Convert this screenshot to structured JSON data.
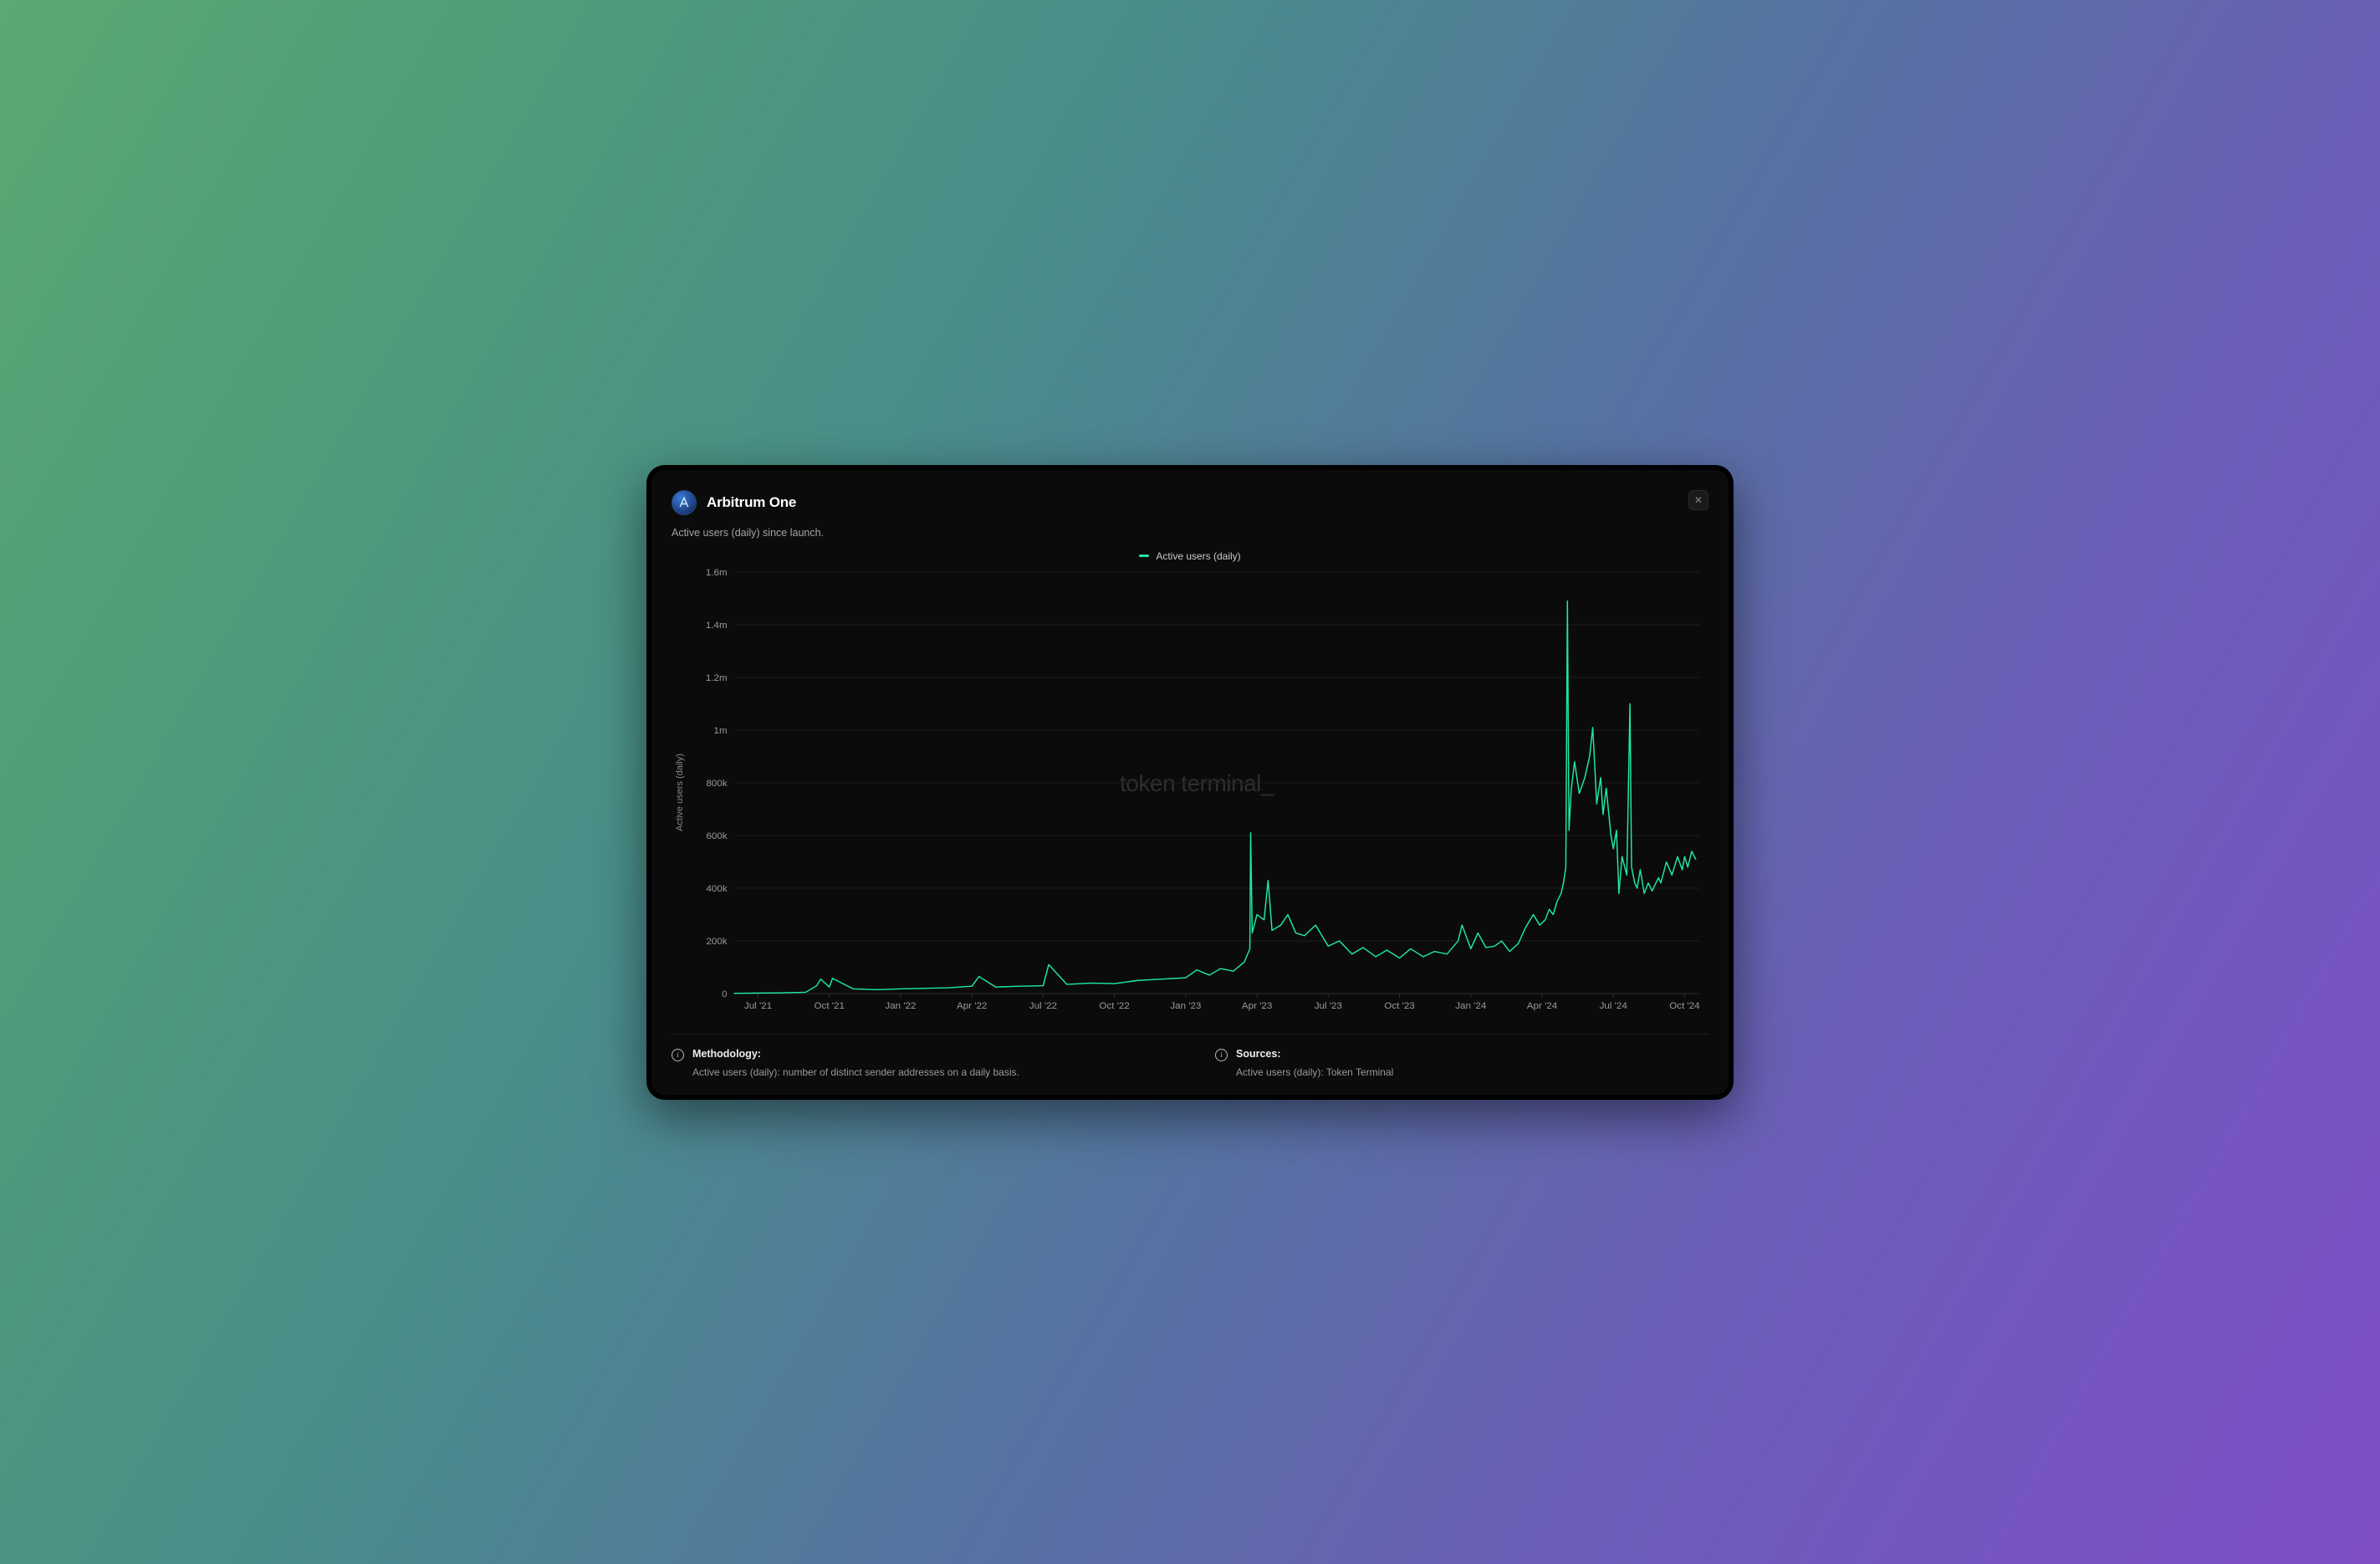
{
  "header": {
    "title": "Arbitrum One",
    "subtitle": "Active users (daily) since launch.",
    "close_label": "✕"
  },
  "legend": {
    "series_label": "Active users (daily)",
    "series_color": "#1de9a4"
  },
  "watermark": "token terminal_",
  "footer": {
    "methodology_heading": "Methodology:",
    "methodology_body": "Active users (daily): number of distinct sender addresses on a daily basis.",
    "sources_heading": "Sources:",
    "sources_body": "Active users (daily): Token Terminal"
  },
  "chart_data": {
    "type": "line",
    "title": "Arbitrum One — Active users (daily) since launch",
    "xlabel": "",
    "ylabel": "Active users (daily)",
    "ylim": [
      0,
      1600000
    ],
    "x_ticks": [
      "Jul '21",
      "Oct '21",
      "Jan '22",
      "Apr '22",
      "Jul '22",
      "Oct '22",
      "Jan '23",
      "Apr '23",
      "Jul '23",
      "Oct '23",
      "Jan '24",
      "Apr '24",
      "Jul '24",
      "Oct '24"
    ],
    "y_ticks": [
      0,
      200000,
      400000,
      600000,
      800000,
      1000000,
      1200000,
      1400000,
      1600000
    ],
    "y_tick_labels": [
      "0",
      "200k",
      "400k",
      "600k",
      "800k",
      "1m",
      "1.2m",
      "1.4m",
      "1.6m"
    ],
    "legend_entries": [
      "Active users (daily)"
    ],
    "series": [
      {
        "name": "Active users (daily)",
        "color": "#1de9a4",
        "x": [
          "2021-06",
          "2021-07",
          "2021-08",
          "2021-09-01",
          "2021-09-15",
          "2021-09-20",
          "2021-10-01",
          "2021-10-05",
          "2021-11",
          "2021-12",
          "2022-01",
          "2022-02",
          "2022-03",
          "2022-04-01",
          "2022-04-10",
          "2022-05",
          "2022-06",
          "2022-07-01",
          "2022-07-08",
          "2022-08",
          "2022-09",
          "2022-10",
          "2022-11",
          "2022-12",
          "2023-01-01",
          "2023-01-15",
          "2023-02-01",
          "2023-02-15",
          "2023-03-01",
          "2023-03-15",
          "2023-03-22",
          "2023-03-23",
          "2023-03-25",
          "2023-04-01",
          "2023-04-10",
          "2023-04-15",
          "2023-04-20",
          "2023-05-01",
          "2023-05-10",
          "2023-05-20",
          "2023-06-01",
          "2023-06-15",
          "2023-07",
          "2023-07-15",
          "2023-08",
          "2023-08-15",
          "2023-09",
          "2023-09-15",
          "2023-10",
          "2023-10-15",
          "2023-11",
          "2023-11-15",
          "2023-12",
          "2023-12-15",
          "2023-12-20",
          "2024-01-01",
          "2024-01-10",
          "2024-01-20",
          "2024-02-01",
          "2024-02-10",
          "2024-02-20",
          "2024-03-01",
          "2024-03-10",
          "2024-03-20",
          "2024-03-28",
          "2024-04-05",
          "2024-04-10",
          "2024-04-15",
          "2024-04-20",
          "2024-04-25",
          "2024-04-28",
          "2024-05-01",
          "2024-05-03",
          "2024-05-05",
          "2024-05-08",
          "2024-05-12",
          "2024-05-18",
          "2024-05-25",
          "2024-06-01",
          "2024-06-05",
          "2024-06-10",
          "2024-06-15",
          "2024-06-18",
          "2024-06-22",
          "2024-06-28",
          "2024-07-01",
          "2024-07-05",
          "2024-07-08",
          "2024-07-12",
          "2024-07-18",
          "2024-07-22",
          "2024-07-24",
          "2024-07-28",
          "2024-08-01",
          "2024-08-05",
          "2024-08-10",
          "2024-08-15",
          "2024-08-20",
          "2024-08-28",
          "2024-09-01",
          "2024-09-08",
          "2024-09-15",
          "2024-09-22",
          "2024-09-28",
          "2024-10-01",
          "2024-10-05",
          "2024-10-10",
          "2024-10-15"
        ],
        "values": [
          1000,
          2000,
          3000,
          5000,
          30000,
          55000,
          25000,
          58000,
          18000,
          15000,
          18000,
          20000,
          22000,
          28000,
          65000,
          25000,
          28000,
          30000,
          110000,
          35000,
          40000,
          38000,
          50000,
          55000,
          60000,
          90000,
          70000,
          95000,
          85000,
          120000,
          170000,
          610000,
          230000,
          300000,
          280000,
          430000,
          240000,
          260000,
          300000,
          230000,
          220000,
          260000,
          180000,
          200000,
          150000,
          175000,
          140000,
          165000,
          135000,
          170000,
          140000,
          160000,
          150000,
          200000,
          260000,
          170000,
          230000,
          175000,
          180000,
          200000,
          160000,
          190000,
          250000,
          300000,
          260000,
          280000,
          320000,
          300000,
          350000,
          380000,
          420000,
          480000,
          1490000,
          620000,
          780000,
          880000,
          760000,
          820000,
          900000,
          1010000,
          720000,
          820000,
          680000,
          780000,
          600000,
          550000,
          620000,
          380000,
          520000,
          450000,
          1100000,
          480000,
          420000,
          400000,
          470000,
          380000,
          420000,
          390000,
          440000,
          420000,
          500000,
          450000,
          520000,
          470000,
          520000,
          480000,
          540000,
          510000
        ]
      }
    ]
  }
}
